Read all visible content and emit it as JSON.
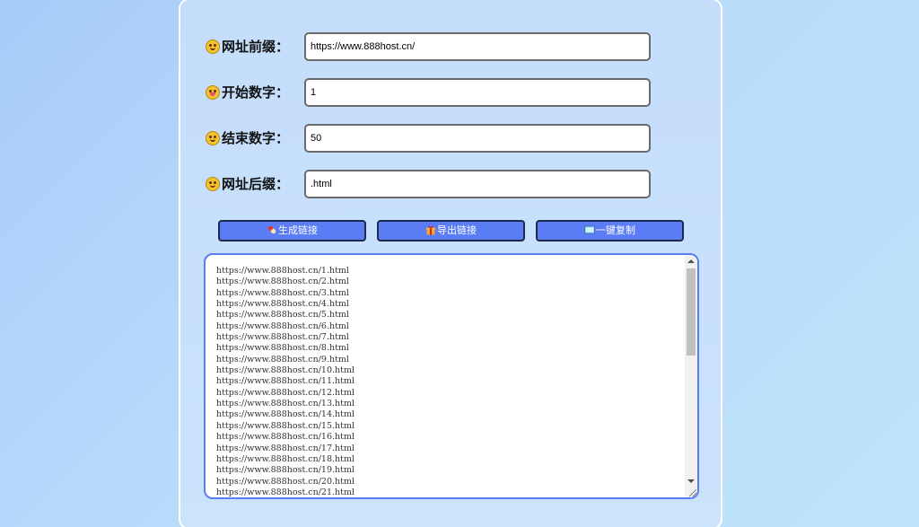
{
  "form": {
    "prefix": {
      "label": "网址前缀：",
      "value": "https://www.888host.cn/"
    },
    "start": {
      "label": "开始数字：",
      "value": "1"
    },
    "end": {
      "label": "结束数字：",
      "value": "50"
    },
    "suffix": {
      "label": "网址后缀：",
      "value": ".html"
    }
  },
  "buttons": {
    "generate": "生成链接",
    "export": "导出链接",
    "copy": "一键复制"
  },
  "output": {
    "lines": [
      "https://www.888host.cn/1.html",
      "https://www.888host.cn/2.html",
      "https://www.888host.cn/3.html",
      "https://www.888host.cn/4.html",
      "https://www.888host.cn/5.html",
      "https://www.888host.cn/6.html",
      "https://www.888host.cn/7.html",
      "https://www.888host.cn/8.html",
      "https://www.888host.cn/9.html",
      "https://www.888host.cn/10.html",
      "https://www.888host.cn/11.html",
      "https://www.888host.cn/12.html",
      "https://www.888host.cn/13.html",
      "https://www.888host.cn/14.html",
      "https://www.888host.cn/15.html",
      "https://www.888host.cn/16.html",
      "https://www.888host.cn/17.html",
      "https://www.888host.cn/18.html",
      "https://www.888host.cn/19.html",
      "https://www.888host.cn/20.html",
      "https://www.888host.cn/21.html"
    ]
  },
  "icons": {
    "prefix": "grinning-face-icon",
    "start": "tongue-face-icon",
    "end": "smiling-face-icon",
    "suffix": "blushing-face-icon",
    "generate": "pill-icon",
    "export": "gift-icon",
    "copy": "keyboard-icon"
  },
  "colors": {
    "button": "#5a7cf5",
    "output_border": "#5a7cf5"
  }
}
